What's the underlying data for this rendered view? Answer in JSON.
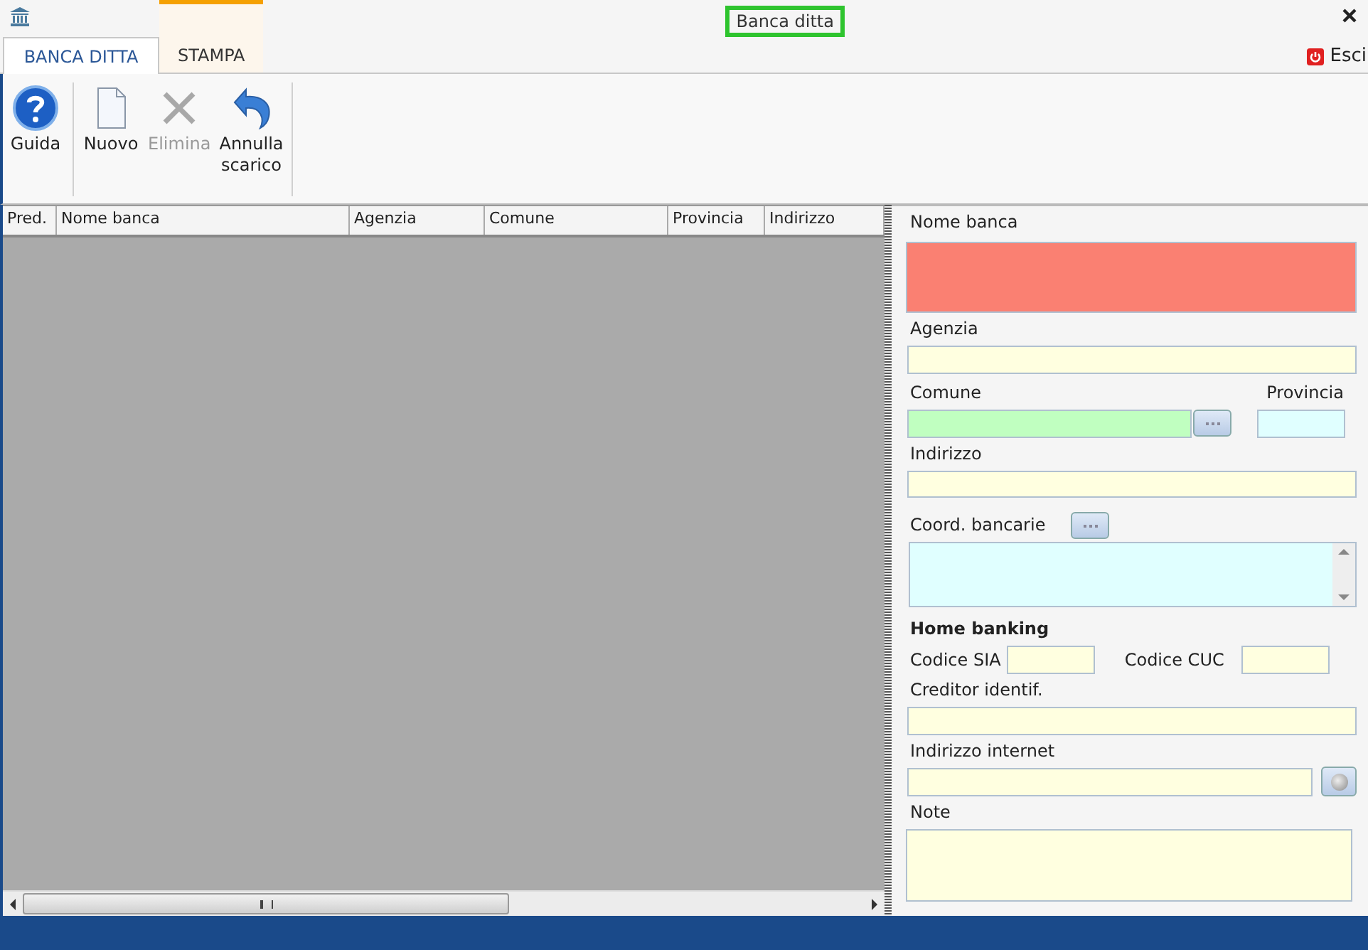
{
  "window": {
    "title": "Banca ditta"
  },
  "tabs": [
    {
      "label": "BANCA DITTA",
      "selected": true
    },
    {
      "label": "STAMPA",
      "selected": false
    }
  ],
  "exit": {
    "label": "Esci"
  },
  "toolbar": [
    {
      "kind": "help",
      "label": "Guida",
      "disabled": false
    },
    {
      "kind": "new",
      "label": "Nuovo",
      "disabled": false
    },
    {
      "kind": "delete",
      "label": "Elimina",
      "disabled": true
    },
    {
      "kind": "undo",
      "label": "Annulla scarico",
      "disabled": false
    }
  ],
  "table": {
    "columns": [
      "Pred.",
      "Nome banca",
      "Agenzia",
      "Comune",
      "Provincia",
      "Indirizzo"
    ]
  },
  "form": {
    "nome_banca": {
      "label": "Nome banca",
      "color": "#fa8072"
    },
    "agenzia": {
      "label": "Agenzia",
      "color": "#ffffe0"
    },
    "comune": {
      "label": "Comune",
      "color": "#c0ffc0"
    },
    "provincia": {
      "label": "Provincia",
      "color": "#e0ffff"
    },
    "indirizzo": {
      "label": "Indirizzo",
      "color": "#ffffe0"
    },
    "coord_bancarie": {
      "label": "Coord. bancarie",
      "color": "#e0ffff"
    },
    "home_banking": "Home banking",
    "codice_sia": {
      "label": "Codice SIA",
      "color": "#ffffe0"
    },
    "codice_cuc": {
      "label": "Codice CUC",
      "color": "#ffffe0"
    },
    "creditor": {
      "label": "Creditor identif.",
      "color": "#ffffe0"
    },
    "indirizzo_internet": {
      "label": "Indirizzo internet",
      "color": "#ffffe0"
    },
    "note": {
      "label": "Note",
      "color": "#ffffe0"
    }
  }
}
